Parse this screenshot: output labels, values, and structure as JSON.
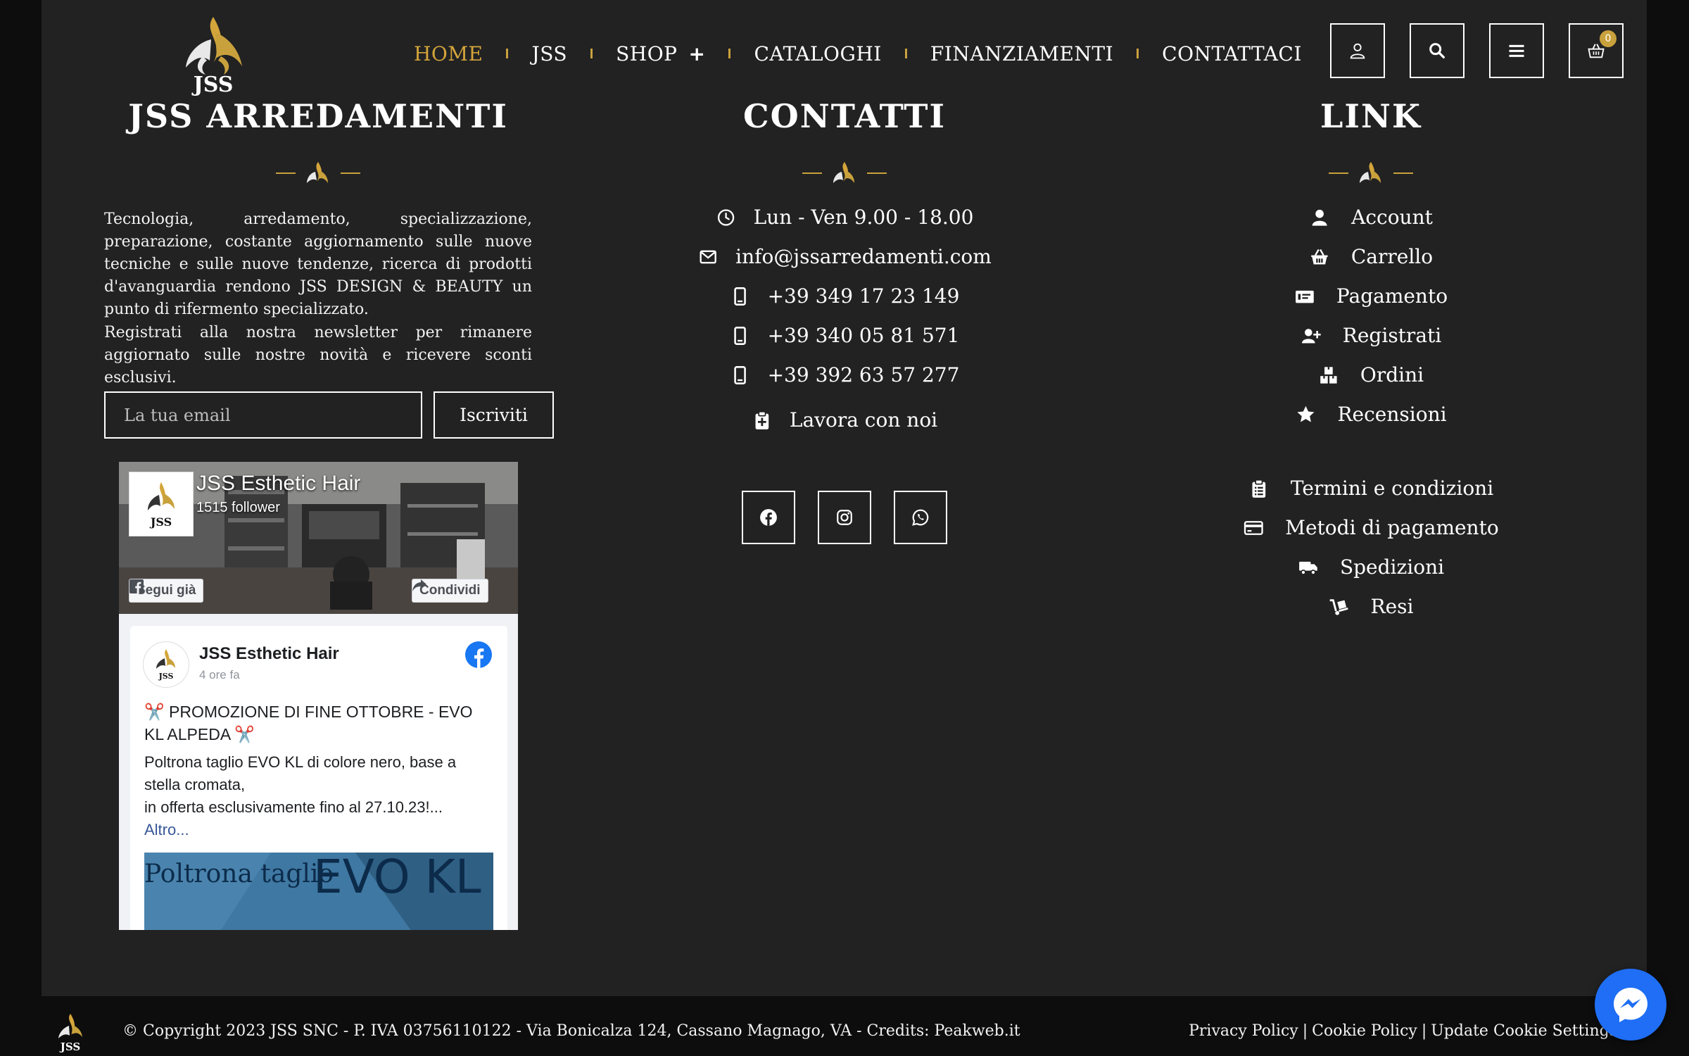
{
  "brand": {
    "logo_text": "JSS",
    "gold": "#c9a13c",
    "background": "#222223"
  },
  "nav": {
    "items": [
      {
        "label": "HOME",
        "active": true
      },
      {
        "label": "JSS"
      },
      {
        "label": "SHOP",
        "has_submenu": true,
        "submenu_symbol": "+"
      },
      {
        "label": "CATALOGHI"
      },
      {
        "label": "FINANZIAMENTI"
      },
      {
        "label": "CONTATTACI"
      }
    ]
  },
  "header_actions": {
    "account_icon": "user-icon",
    "search_icon": "search-icon",
    "menu_icon": "hamburger-icon",
    "cart_icon": "basket-icon",
    "cart_count": "0"
  },
  "about": {
    "title": "JSS ARREDAMENTI",
    "description": "Tecnologia, arredamento, specializzazione, preparazione, costante aggiornamento sulle nuove tecniche e sulle nuove tendenze, ricerca di prodotti d'avanguardia rendono JSS DESIGN & BEAUTY un punto di rifermento specializzato.",
    "newsletter_text": "Registrati alla nostra newsletter per rimanere aggiornato sulle nostre novità e ricevere sconti esclusivi.",
    "email_placeholder": "La tua email",
    "subscribe_label": "Iscriviti"
  },
  "facebook_widget": {
    "page_name": "JSS Esthetic Hair",
    "followers": "1515 follower",
    "follow_label": "Segui già",
    "share_label": "Condividi",
    "post": {
      "author": "JSS Esthetic Hair",
      "time": "4 ore fa",
      "title": "✂️ PROMOZIONE DI FINE OTTOBRE - EVO KL ALPEDA ✂️",
      "body": "Poltrona taglio EVO KL di colore nero, base a stella cromata,\nin offerta esclusivamente fino al 27.10.23!...",
      "more_label": "Altro...",
      "image_text_1": "Poltrona taglio",
      "image_text_2": "EVO KL"
    }
  },
  "contacts": {
    "title": "CONTATTI",
    "items": [
      {
        "icon": "clock-icon",
        "text": "Lun - Ven 9.00 - 18.00"
      },
      {
        "icon": "envelope-icon",
        "text": "info@jssarredamenti.com"
      },
      {
        "icon": "mobile-phone-icon",
        "text": "+39 349 17 23 149"
      },
      {
        "icon": "mobile-phone-icon",
        "text": "+39 340 05 81 571"
      },
      {
        "icon": "mobile-phone-icon",
        "text": "+39 392 63 57 277"
      },
      {
        "icon": "clipboard-plus-icon",
        "text": "Lavora con noi"
      }
    ],
    "social": [
      {
        "icon": "facebook-icon"
      },
      {
        "icon": "instagram-icon"
      },
      {
        "icon": "whatsapp-icon"
      }
    ]
  },
  "links": {
    "title": "LINK",
    "items": [
      {
        "icon": "user-icon",
        "text": "Account"
      },
      {
        "icon": "basket-icon",
        "text": "Carrello"
      },
      {
        "icon": "money-check-icon",
        "text": "Pagamento"
      },
      {
        "icon": "user-plus-icon",
        "text": "Registrati"
      },
      {
        "icon": "boxes-icon",
        "text": "Ordini"
      },
      {
        "icon": "star-icon",
        "text": "Recensioni"
      },
      {
        "icon": "clipboard-list-icon",
        "text": "Termini e condizioni"
      },
      {
        "icon": "credit-card-icon",
        "text": "Metodi di pagamento"
      },
      {
        "icon": "truck-icon",
        "text": "Spedizioni"
      },
      {
        "icon": "dolly-icon",
        "text": "Resi"
      }
    ]
  },
  "footer": {
    "copyright": "© Copyright 2023 JSS SNC - P. IVA 03756110122 - Via Bonicalza 124, Cassano Magnago, VA - Credits: Peakweb.it",
    "legal_links": [
      "Privacy Policy",
      "Cookie Policy",
      "Update Cookie Settings"
    ],
    "separator": "|"
  },
  "chat": {
    "icon": "messenger-icon",
    "color": "#1f6ef5"
  }
}
